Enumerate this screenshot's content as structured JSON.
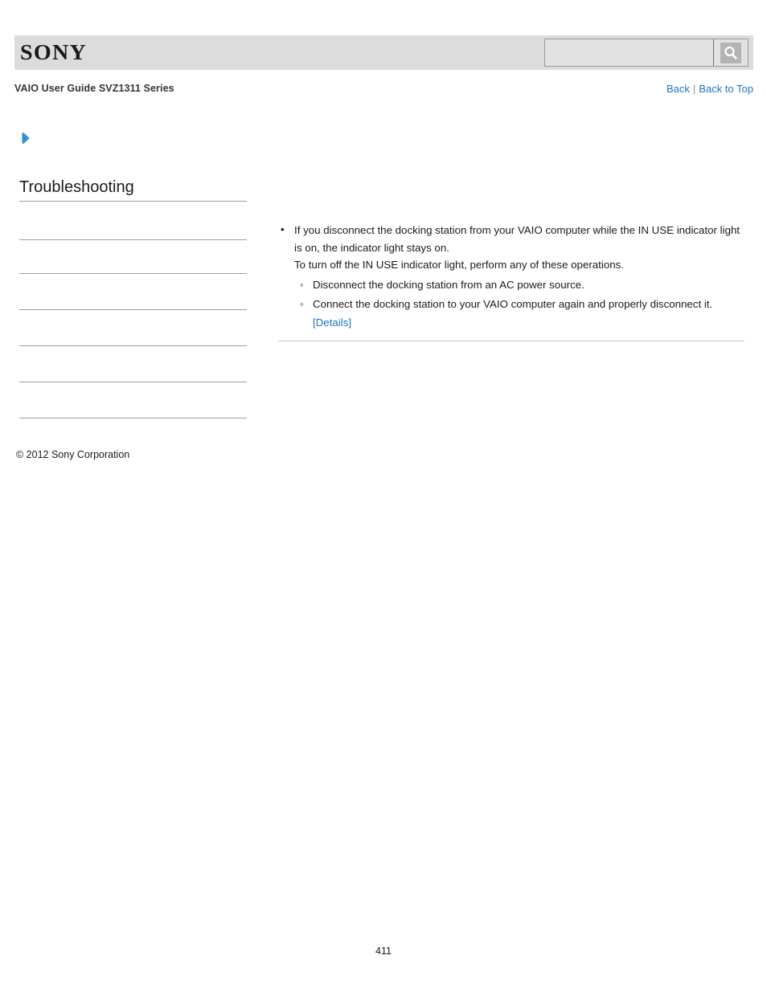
{
  "header": {
    "logo_text": "SONY",
    "logo_bg_color": "#dcdcdc",
    "search": {
      "value": "",
      "placeholder": "",
      "button_icon": "search-icon"
    }
  },
  "subheader": {
    "guide_title": "VAIO User Guide SVZ1311 Series",
    "nav": {
      "back_label": "Back",
      "separator": "|",
      "back_to_top_label": "Back to Top",
      "link_color": "#1f72c4"
    }
  },
  "sidebar": {
    "chevron_icon": "chevron-right-icon",
    "chevron_color": "#2e8fd0",
    "heading": "Troubleshooting",
    "separator_count": 7,
    "items": [
      "",
      "",
      "",
      "",
      "",
      "",
      ""
    ],
    "copyright": "© 2012 Sony Corporation"
  },
  "content": {
    "bullets": [
      {
        "lines": [
          "If you disconnect the docking station from your VAIO computer while the IN USE indicator light is on, the indicator light stays on.",
          "To turn off the IN USE indicator light, perform any of these operations."
        ],
        "subbullets": [
          {
            "text": "Disconnect the docking station from an AC power source.",
            "link": null
          },
          {
            "text": "Connect the docking station to your VAIO computer again and properly disconnect it.",
            "link": "[Details]"
          }
        ]
      }
    ]
  },
  "footer": {
    "page_number": "411"
  }
}
